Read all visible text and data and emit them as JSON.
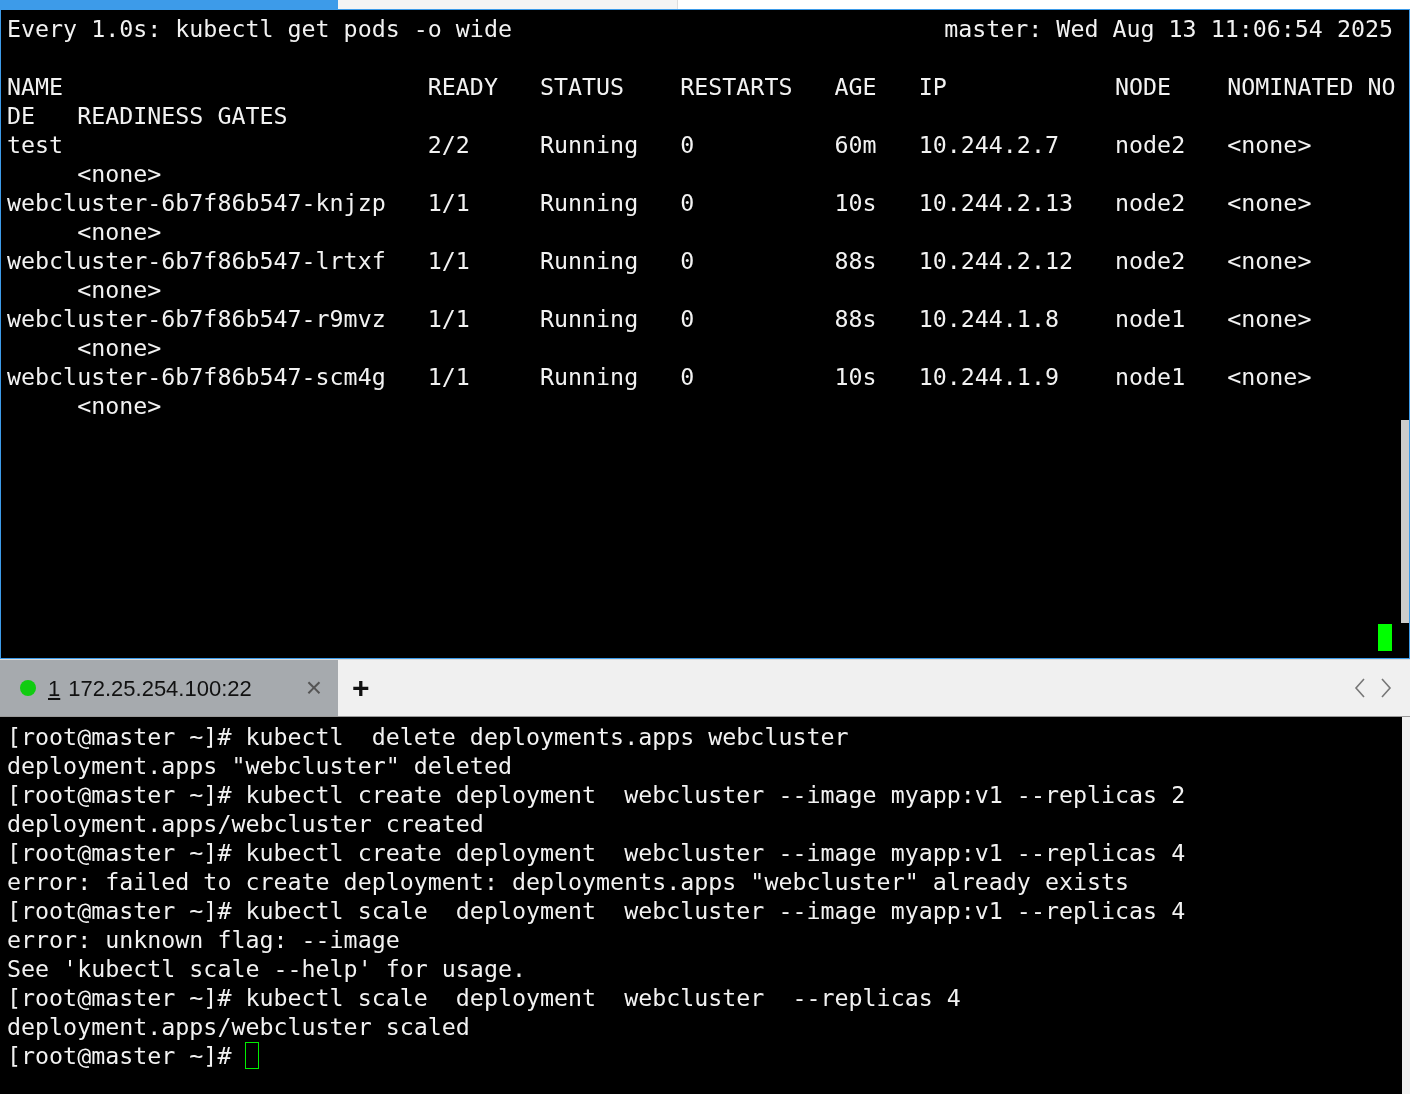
{
  "watch": {
    "command": "Every 1.0s: kubectl get pods -o wide",
    "host_time": "master: Wed Aug 13 11:06:54 2025",
    "lines": [
      "NAME                          READY   STATUS    RESTARTS   AGE   IP            NODE    NOMINATED NO",
      "DE   READINESS GATES",
      "test                          2/2     Running   0          60m   10.244.2.7    node2   <none>",
      "     <none>",
      "webcluster-6b7f86b547-knjzp   1/1     Running   0          10s   10.244.2.13   node2   <none>",
      "     <none>",
      "webcluster-6b7f86b547-lrtxf   1/1     Running   0          88s   10.244.2.12   node2   <none>",
      "     <none>",
      "webcluster-6b7f86b547-r9mvz   1/1     Running   0          88s   10.244.1.8    node1   <none>",
      "     <none>",
      "webcluster-6b7f86b547-scm4g   1/1     Running   0          10s   10.244.1.9    node1   <none>",
      "     <none>"
    ]
  },
  "session_tabs": [
    {
      "number": "1",
      "label": "172.25.254.100:22",
      "close": "×",
      "selected": true,
      "connected": true
    }
  ],
  "new_tab": "+",
  "shell": {
    "lines": [
      "[root@master ~]# kubectl  delete deployments.apps webcluster",
      "deployment.apps \"webcluster\" deleted",
      "[root@master ~]# kubectl create deployment  webcluster --image myapp:v1 --replicas 2",
      "deployment.apps/webcluster created",
      "[root@master ~]# kubectl create deployment  webcluster --image myapp:v1 --replicas 4",
      "error: failed to create deployment: deployments.apps \"webcluster\" already exists",
      "[root@master ~]# kubectl scale  deployment  webcluster --image myapp:v1 --replicas 4",
      "error: unknown flag: --image",
      "See 'kubectl scale --help' for usage.",
      "[root@master ~]# kubectl scale  deployment  webcluster  --replicas 4",
      "deployment.apps/webcluster scaled"
    ],
    "prompt": "[root@master ~]# "
  }
}
